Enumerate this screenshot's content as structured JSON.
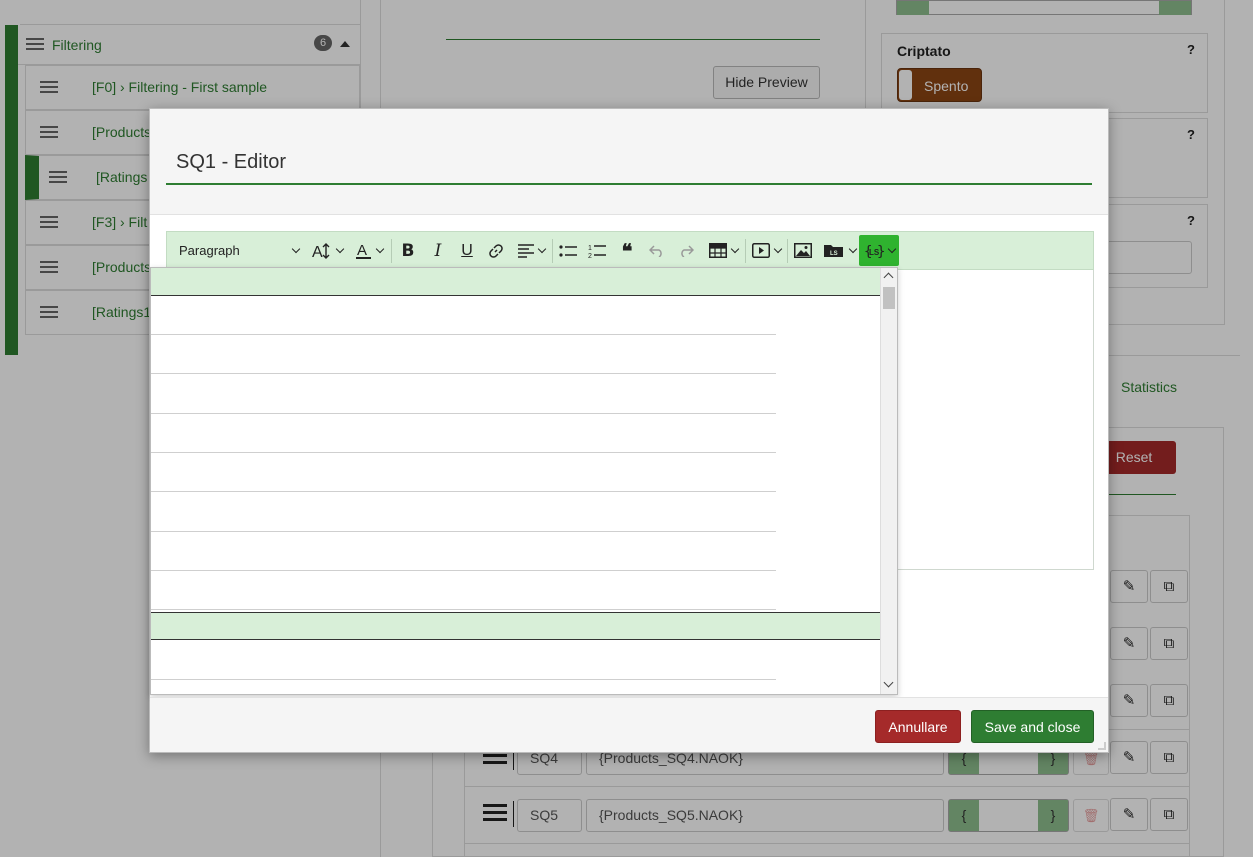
{
  "sidebar": {
    "group": {
      "label": "Filtering",
      "count": "6"
    },
    "items": [
      {
        "label": "[F0] › Filtering - First sample"
      },
      {
        "label": "[Products"
      },
      {
        "label": "[Ratings"
      },
      {
        "label": "[F3] › Filt"
      },
      {
        "label": "[Products"
      },
      {
        "label": "[Ratings1"
      }
    ]
  },
  "preview": {
    "hide_label": "Hide Preview"
  },
  "settings": {
    "encrypted_title": "Criptato",
    "help_mark": "?",
    "toggle_label": "Spento"
  },
  "tabs": {
    "statistics": "Statistics"
  },
  "subquestions": {
    "reset_label": "Reset",
    "rows": [
      {
        "code": "SQ4",
        "expression": "{Products_SQ4.NAOK}"
      },
      {
        "code": "SQ5",
        "expression": "{Products_SQ5.NAOK}"
      }
    ],
    "brace_open": "{",
    "brace_close": "}"
  },
  "modal": {
    "title": "SQ1 - Editor",
    "cancel_label": "Annullare",
    "save_label": "Save and close"
  },
  "toolbar": {
    "paragraph_label": "Paragraph",
    "icons": [
      "text-size-icon",
      "font-color-icon",
      "bold-icon",
      "italic-icon",
      "underline-icon",
      "link-icon",
      "align-icon",
      "bulleted-list-icon",
      "numbered-list-icon",
      "blockquote-icon",
      "undo-icon",
      "redo-icon",
      "table-icon",
      "media-icon",
      "image-icon",
      "file-manager-icon",
      "expression-icon"
    ]
  }
}
